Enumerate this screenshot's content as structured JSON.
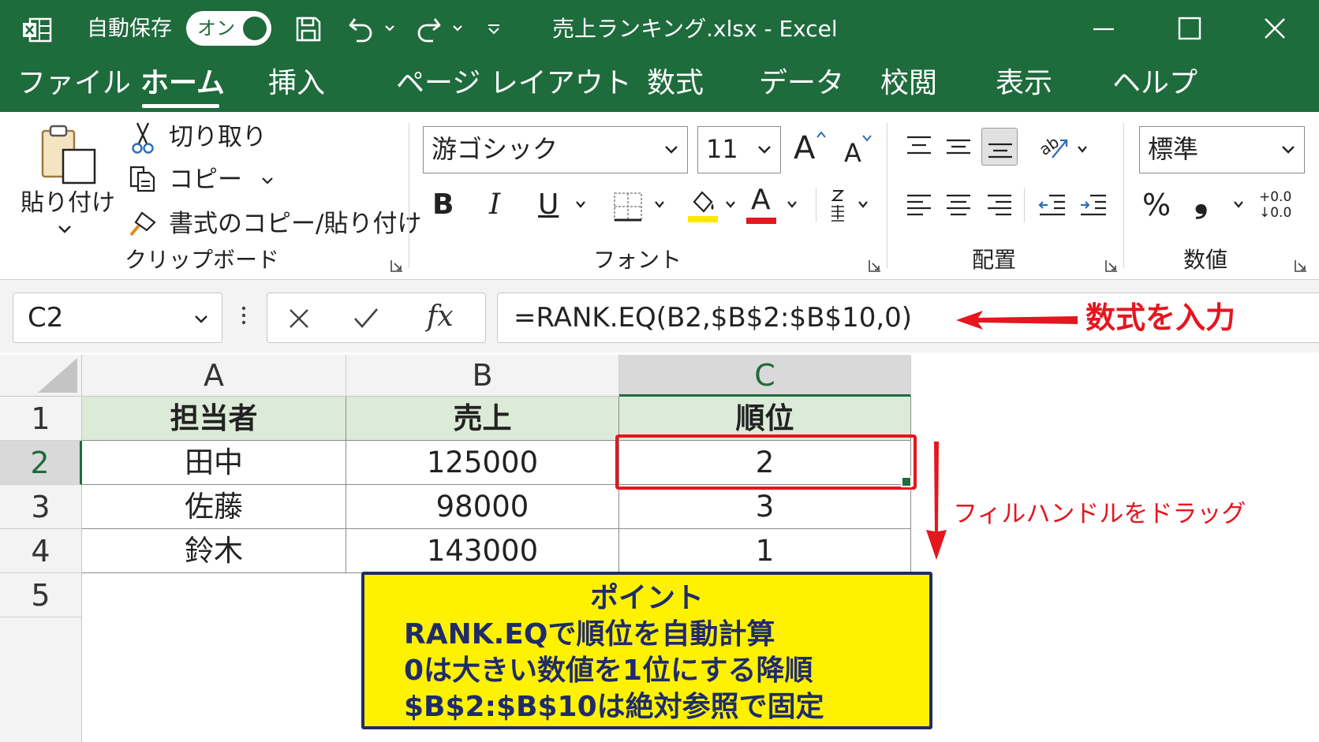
{
  "window": {
    "autosave_label": "自動保存",
    "autosave_state": "オン",
    "doc_title": "売上ランキング.xlsx  -  Excel"
  },
  "tabs": [
    "ファイル",
    "ホーム",
    "挿入",
    "ページ レイアウト",
    "数式",
    "データ",
    "校閲",
    "表示",
    "ヘルプ"
  ],
  "ribbon": {
    "clipboard": {
      "paste_label": "貼り付け",
      "cut_label": "切り取り",
      "copy_label": "コピー",
      "format_painter_label": "書式のコピー/貼り付け",
      "group_label": "クリップボード"
    },
    "font": {
      "font_name": "游ゴシック",
      "font_size": "11",
      "bold": "B",
      "italic": "I",
      "underline": "U",
      "grow": "A",
      "shrink": "A",
      "font_color_glyph": "A",
      "group_label": "フォント"
    },
    "alignment": {
      "group_label": "配置"
    },
    "number": {
      "format": "標準",
      "percent": "%",
      "comma": "❟",
      "inc_decimal": "+0.0",
      "dec_decimal": "↓0.0",
      "group_label": "数値"
    }
  },
  "formula_bar": {
    "name_box": "C2",
    "fx": "fx",
    "formula": "=RANK.EQ(B2,$B$2:$B$10,0)"
  },
  "sheet": {
    "columns": [
      "A",
      "B",
      "C"
    ],
    "rows": [
      "1",
      "2",
      "3",
      "4",
      "5"
    ],
    "header": [
      "担当者",
      "売上",
      "順位"
    ],
    "data": [
      [
        "田中",
        "125000",
        "2"
      ],
      [
        "佐藤",
        "98000",
        "3"
      ],
      [
        "鈴木",
        "143000",
        "1"
      ]
    ]
  },
  "annotations": {
    "formula_note": "数式を入力",
    "drag_note": "フィルハンドルをドラッグ",
    "callout_title": "ポイント",
    "callout_lines": [
      "RANK.EQで順位を自動計算",
      "0は大きい数値を1位にする降順",
      "$B$2:$B$10は絶対参照で固定"
    ]
  },
  "colors": {
    "excel_green": "#1e6b3c",
    "header_fill": "#dcead8",
    "annotation_red": "#e5161f",
    "callout_fill": "#fff200",
    "callout_text": "#1f2b6b"
  }
}
